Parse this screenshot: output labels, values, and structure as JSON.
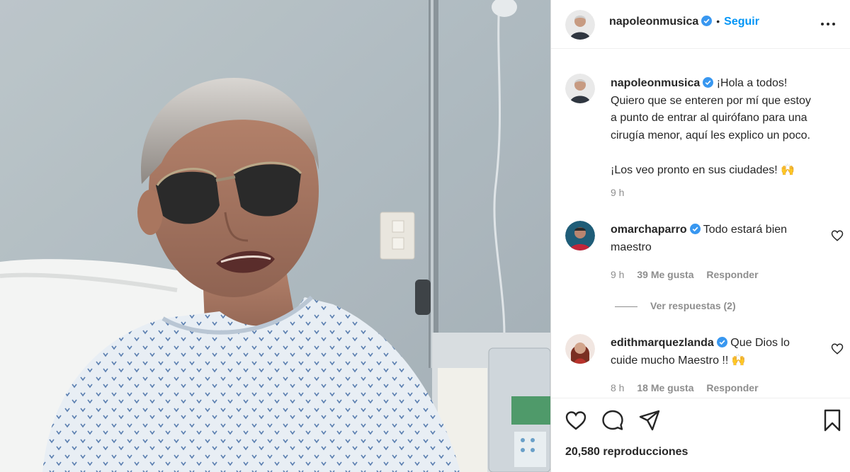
{
  "post": {
    "author": "napoleonmusica",
    "follow_label": "Seguir",
    "caption_lines": [
      "¡Hola a todos!",
      "Quiero que se enteren por mí que estoy",
      "a punto de entrar al quirófano para una",
      "cirugía menor, aquí les explico un poco."
    ],
    "caption_closing": "¡Los veo pronto en sus ciudades! 🙌",
    "time": "9 h",
    "views": "20,580 reproducciones"
  },
  "comments": [
    {
      "user": "omarchaparro",
      "text": "Todo estará bien maestro",
      "line1": "Todo estará bien",
      "line2": "maestro",
      "time": "9 h",
      "likes": "39 Me gusta",
      "reply_label": "Responder",
      "view_replies": "Ver respuestas (2)"
    },
    {
      "user": "edithmarquezlanda",
      "text": "Que Dios lo cuide mucho Maestro !! 🙌",
      "line1": "Que Dios lo",
      "line2": "cuide mucho Maestro !! 🙌",
      "time": "8 h",
      "likes": "18 Me gusta",
      "reply_label": "Responder"
    }
  ],
  "icons": {
    "verified": "verified-badge-icon",
    "more": "more-options-icon",
    "like": "heart-icon",
    "comment": "comment-icon",
    "share": "share-icon",
    "save": "bookmark-icon"
  },
  "colors": {
    "accent": "#0095f6",
    "verified": "#3897f0",
    "muted": "#8e8e8e",
    "text": "#262626"
  }
}
